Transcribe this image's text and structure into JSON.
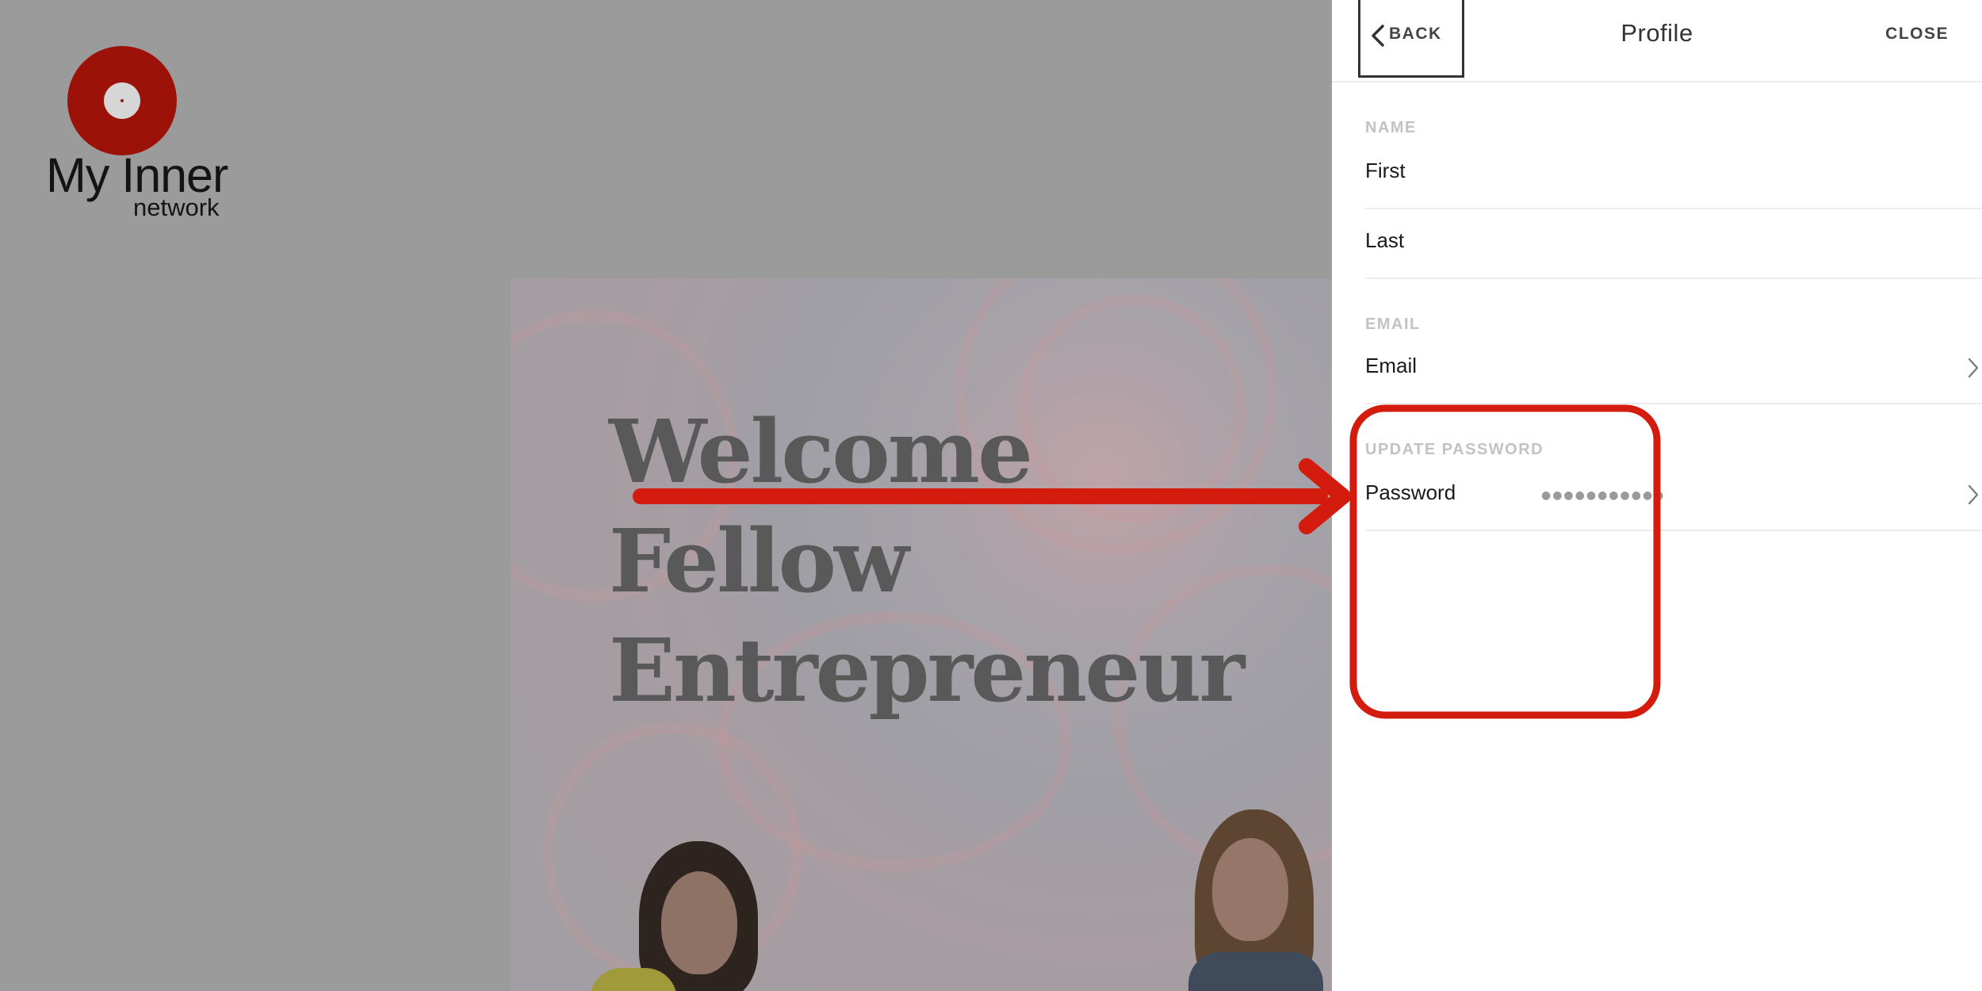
{
  "logo": {
    "title": "My Inner",
    "subtitle": "network"
  },
  "hero": {
    "lines": [
      "Welcome",
      "Fellow",
      "Entrepreneur"
    ]
  },
  "panel": {
    "back_label": "BACK",
    "title": "Profile",
    "close_label": "CLOSE",
    "name_section": "NAME",
    "first_label": "First",
    "last_label": "Last",
    "email_section": "EMAIL",
    "email_label": "Email",
    "password_section": "UPDATE PASSWORD",
    "password_label": "Password",
    "password_masked": "●●●●●●●●●●●"
  },
  "colors": {
    "annotation": "#d31c0e",
    "logo_red": "#9c1208",
    "dim_overlay": "#9b9b9b",
    "panel_bg": "#ffffff"
  },
  "icons": [
    "logo-disc-icon",
    "chevron-left-icon",
    "chevron-right-icon",
    "annotation-arrow",
    "annotation-highlight-box"
  ]
}
